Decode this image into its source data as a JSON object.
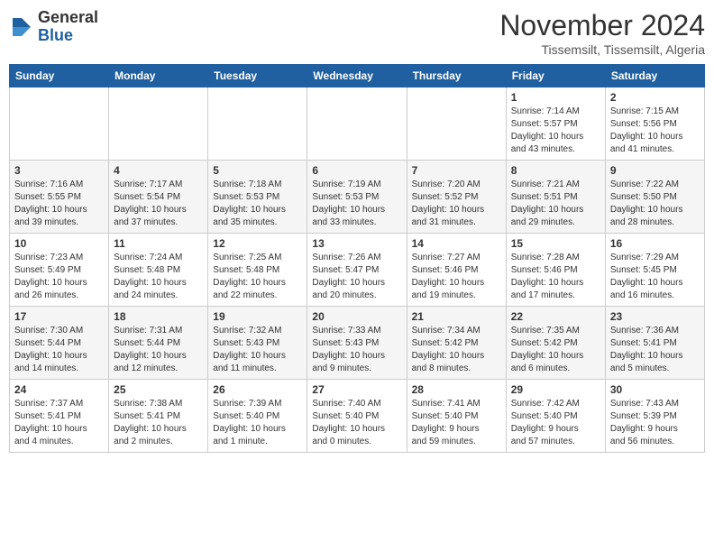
{
  "header": {
    "logo_general": "General",
    "logo_blue": "Blue",
    "month_title": "November 2024",
    "location": "Tissemsilt, Tissemsilt, Algeria"
  },
  "weekdays": [
    "Sunday",
    "Monday",
    "Tuesday",
    "Wednesday",
    "Thursday",
    "Friday",
    "Saturday"
  ],
  "weeks": [
    [
      {
        "day": "",
        "info": ""
      },
      {
        "day": "",
        "info": ""
      },
      {
        "day": "",
        "info": ""
      },
      {
        "day": "",
        "info": ""
      },
      {
        "day": "",
        "info": ""
      },
      {
        "day": "1",
        "info": "Sunrise: 7:14 AM\nSunset: 5:57 PM\nDaylight: 10 hours\nand 43 minutes."
      },
      {
        "day": "2",
        "info": "Sunrise: 7:15 AM\nSunset: 5:56 PM\nDaylight: 10 hours\nand 41 minutes."
      }
    ],
    [
      {
        "day": "3",
        "info": "Sunrise: 7:16 AM\nSunset: 5:55 PM\nDaylight: 10 hours\nand 39 minutes."
      },
      {
        "day": "4",
        "info": "Sunrise: 7:17 AM\nSunset: 5:54 PM\nDaylight: 10 hours\nand 37 minutes."
      },
      {
        "day": "5",
        "info": "Sunrise: 7:18 AM\nSunset: 5:53 PM\nDaylight: 10 hours\nand 35 minutes."
      },
      {
        "day": "6",
        "info": "Sunrise: 7:19 AM\nSunset: 5:53 PM\nDaylight: 10 hours\nand 33 minutes."
      },
      {
        "day": "7",
        "info": "Sunrise: 7:20 AM\nSunset: 5:52 PM\nDaylight: 10 hours\nand 31 minutes."
      },
      {
        "day": "8",
        "info": "Sunrise: 7:21 AM\nSunset: 5:51 PM\nDaylight: 10 hours\nand 29 minutes."
      },
      {
        "day": "9",
        "info": "Sunrise: 7:22 AM\nSunset: 5:50 PM\nDaylight: 10 hours\nand 28 minutes."
      }
    ],
    [
      {
        "day": "10",
        "info": "Sunrise: 7:23 AM\nSunset: 5:49 PM\nDaylight: 10 hours\nand 26 minutes."
      },
      {
        "day": "11",
        "info": "Sunrise: 7:24 AM\nSunset: 5:48 PM\nDaylight: 10 hours\nand 24 minutes."
      },
      {
        "day": "12",
        "info": "Sunrise: 7:25 AM\nSunset: 5:48 PM\nDaylight: 10 hours\nand 22 minutes."
      },
      {
        "day": "13",
        "info": "Sunrise: 7:26 AM\nSunset: 5:47 PM\nDaylight: 10 hours\nand 20 minutes."
      },
      {
        "day": "14",
        "info": "Sunrise: 7:27 AM\nSunset: 5:46 PM\nDaylight: 10 hours\nand 19 minutes."
      },
      {
        "day": "15",
        "info": "Sunrise: 7:28 AM\nSunset: 5:46 PM\nDaylight: 10 hours\nand 17 minutes."
      },
      {
        "day": "16",
        "info": "Sunrise: 7:29 AM\nSunset: 5:45 PM\nDaylight: 10 hours\nand 16 minutes."
      }
    ],
    [
      {
        "day": "17",
        "info": "Sunrise: 7:30 AM\nSunset: 5:44 PM\nDaylight: 10 hours\nand 14 minutes."
      },
      {
        "day": "18",
        "info": "Sunrise: 7:31 AM\nSunset: 5:44 PM\nDaylight: 10 hours\nand 12 minutes."
      },
      {
        "day": "19",
        "info": "Sunrise: 7:32 AM\nSunset: 5:43 PM\nDaylight: 10 hours\nand 11 minutes."
      },
      {
        "day": "20",
        "info": "Sunrise: 7:33 AM\nSunset: 5:43 PM\nDaylight: 10 hours\nand 9 minutes."
      },
      {
        "day": "21",
        "info": "Sunrise: 7:34 AM\nSunset: 5:42 PM\nDaylight: 10 hours\nand 8 minutes."
      },
      {
        "day": "22",
        "info": "Sunrise: 7:35 AM\nSunset: 5:42 PM\nDaylight: 10 hours\nand 6 minutes."
      },
      {
        "day": "23",
        "info": "Sunrise: 7:36 AM\nSunset: 5:41 PM\nDaylight: 10 hours\nand 5 minutes."
      }
    ],
    [
      {
        "day": "24",
        "info": "Sunrise: 7:37 AM\nSunset: 5:41 PM\nDaylight: 10 hours\nand 4 minutes."
      },
      {
        "day": "25",
        "info": "Sunrise: 7:38 AM\nSunset: 5:41 PM\nDaylight: 10 hours\nand 2 minutes."
      },
      {
        "day": "26",
        "info": "Sunrise: 7:39 AM\nSunset: 5:40 PM\nDaylight: 10 hours\nand 1 minute."
      },
      {
        "day": "27",
        "info": "Sunrise: 7:40 AM\nSunset: 5:40 PM\nDaylight: 10 hours\nand 0 minutes."
      },
      {
        "day": "28",
        "info": "Sunrise: 7:41 AM\nSunset: 5:40 PM\nDaylight: 9 hours\nand 59 minutes."
      },
      {
        "day": "29",
        "info": "Sunrise: 7:42 AM\nSunset: 5:40 PM\nDaylight: 9 hours\nand 57 minutes."
      },
      {
        "day": "30",
        "info": "Sunrise: 7:43 AM\nSunset: 5:39 PM\nDaylight: 9 hours\nand 56 minutes."
      }
    ]
  ]
}
